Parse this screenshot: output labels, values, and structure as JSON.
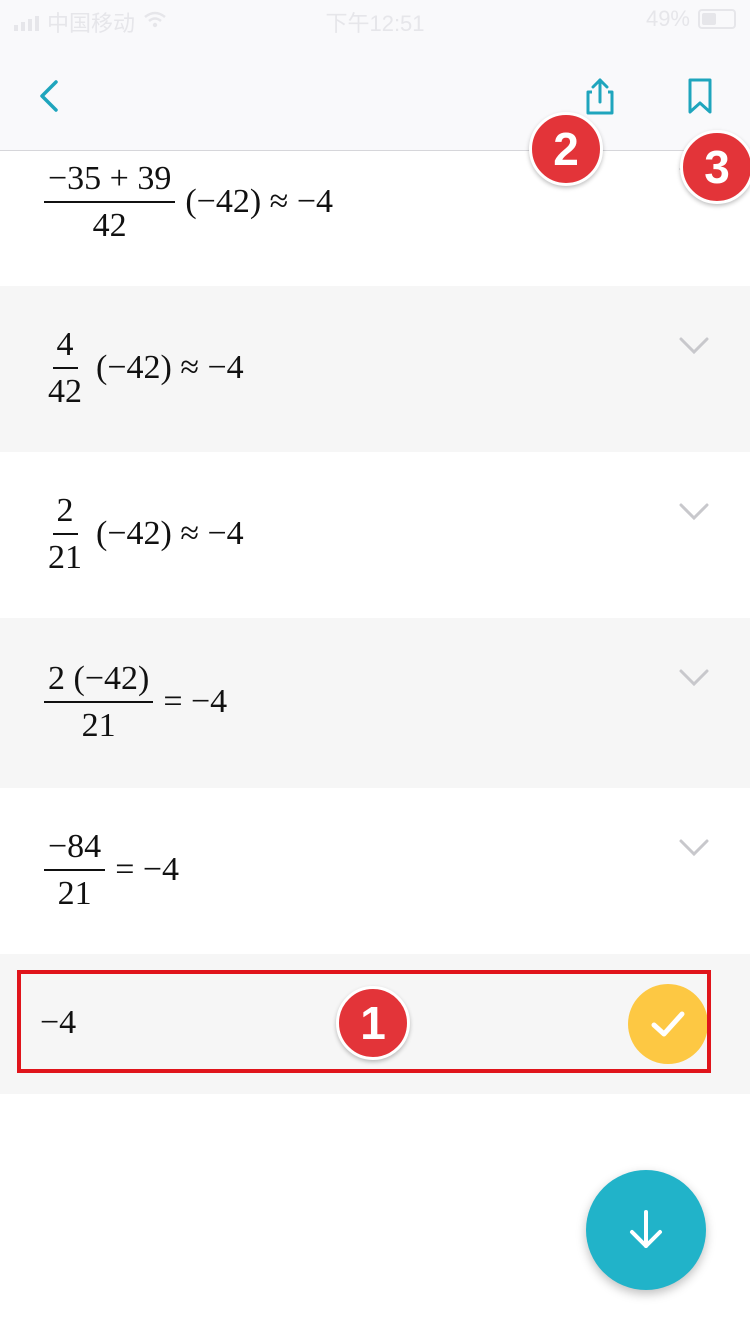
{
  "status_bar": {
    "carrier": "中国移动",
    "time": "下午12:51",
    "battery": "49%"
  },
  "nav": {
    "back_icon": "chevron-left-icon",
    "share_icon": "share-icon",
    "bookmark_icon": "bookmark-icon",
    "accent_color": "#1fa5bd"
  },
  "steps": [
    {
      "num": "−35 + 39",
      "den": "42",
      "rest": "(−42) ≈ −4"
    },
    {
      "num": "4",
      "den": "42",
      "rest": "(−42) ≈ −4"
    },
    {
      "num": "2",
      "den": "21",
      "rest": "(−42) ≈ −4"
    },
    {
      "num": "2 (−42)",
      "den": "21",
      "rest": "= −4"
    },
    {
      "num": "−84",
      "den": "21",
      "rest": "= −4"
    }
  ],
  "final": {
    "value": "−4",
    "check_color": "#fdc843"
  },
  "annotations": {
    "badge1": "1",
    "badge2": "2",
    "badge3": "3",
    "color": "#e0141b"
  },
  "fab": {
    "icon": "arrow-down-icon",
    "color": "#21b3c9"
  }
}
